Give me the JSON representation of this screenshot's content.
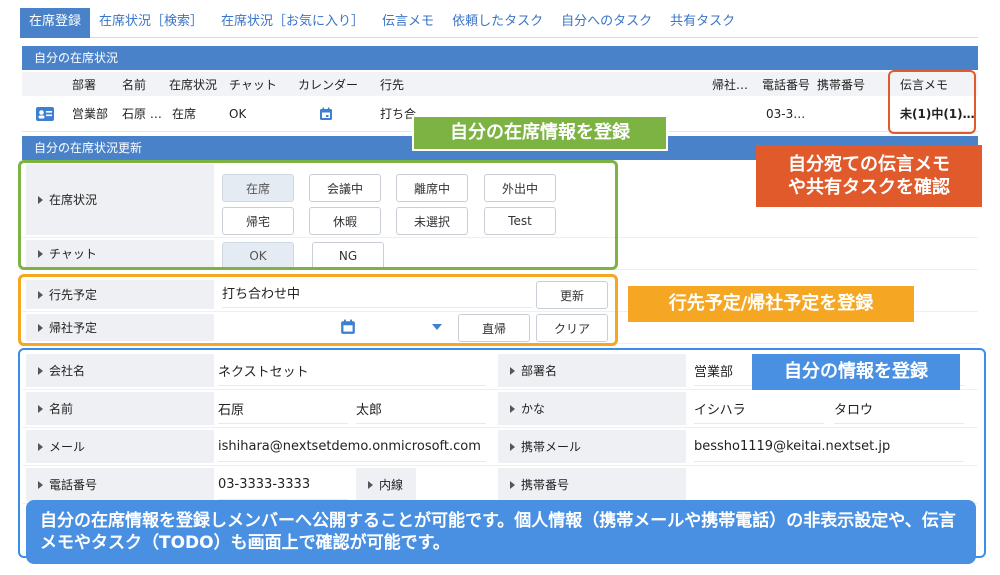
{
  "tabs": [
    "在席登録",
    "在席状況［検索］",
    "在席状況［お気に入り］",
    "伝言メモ",
    "依頼したタスク",
    "自分へのタスク",
    "共有タスク"
  ],
  "my_status": {
    "header": "自分の在席状況",
    "columns": [
      "部署",
      "名前",
      "在席状況",
      "チャット",
      "カレンダー",
      "行先",
      "帰社…",
      "電話番号",
      "携帯番号",
      "伝言メモ"
    ],
    "row": {
      "dept": "営業部",
      "name": "石原 …",
      "status": "在席",
      "chat": "OK",
      "destination": "打ち合…",
      "phone": "03-3…",
      "memo": "未(1)中(1)…"
    }
  },
  "update": {
    "header": "自分の在席状況更新",
    "status_label": "在席状況",
    "status_options": [
      "在席",
      "会議中",
      "離席中",
      "外出中",
      "帰宅",
      "休暇",
      "未選択",
      "Test"
    ],
    "status_selected": "在席",
    "chat_label": "チャット",
    "chat_options": [
      "OK",
      "NG"
    ],
    "chat_selected": "OK",
    "dest_label": "行先予定",
    "dest_value": "打ち合わせ中",
    "update_button": "更新",
    "return_label": "帰社予定",
    "direct_button": "直帰",
    "clear_button": "クリア"
  },
  "profile": {
    "company_label": "会社名",
    "company_value": "ネクストセット",
    "dept_label": "部署名",
    "dept_value": "営業部",
    "name_label": "名前",
    "last_name": "石原",
    "first_name": "太郎",
    "kana_label": "かな",
    "kana_last": "イシハラ",
    "kana_first": "タロウ",
    "email_label": "メール",
    "email_value": "ishihara@nextsetdemo.onmicrosoft.com",
    "mobile_email_label": "携帯メール",
    "mobile_email_value": "bessho1119@keitai.nextset.jp",
    "phone_label": "電話番号",
    "phone_value": "03-3333-3333",
    "ext_label": "内線",
    "mobile_label": "携帯番号"
  },
  "callouts": {
    "register_status": "自分の在席情報を登録",
    "check_memo": "自分宛ての伝言メモ\nや共有タスクを確認",
    "register_schedule": "行先予定/帰社予定を登録",
    "register_info": "自分の情報を登録",
    "summary": "自分の在席情報を登録しメンバーへ公開することが可能です。個人情報（携帯メールや携帯電話）の非表示設定や、伝言メモやタスク（TODO）も画面上で確認が可能です。"
  },
  "colors": {
    "header_blue": "#4a82c9",
    "green": "#7cb342",
    "orange": "#f5a623",
    "red": "#e05a2b",
    "blue_callout": "#4a90e2",
    "outline_blue": "#3a8ee6"
  },
  "icons": [
    "profile-card-icon",
    "calendar-icon",
    "calendar-icon",
    "dropdown-caret-icon"
  ]
}
